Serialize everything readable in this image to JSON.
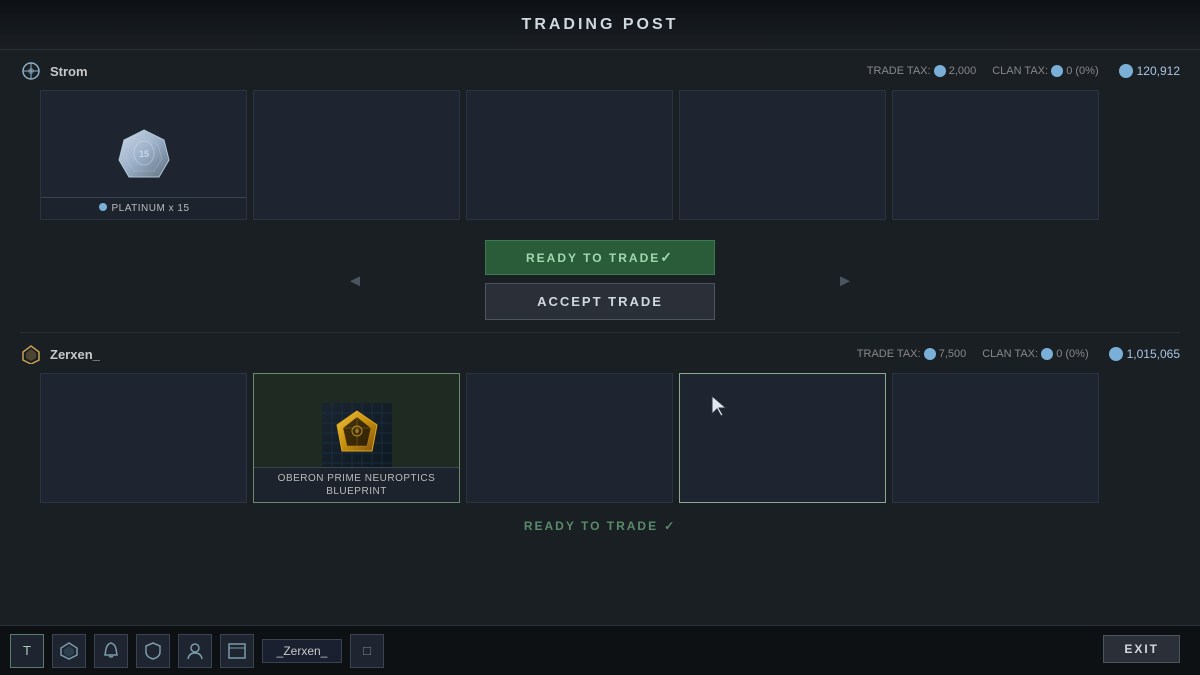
{
  "header": {
    "title": "TRADING POST"
  },
  "player1": {
    "name": "Strom",
    "platinum": "120,912",
    "trade_tax_label": "TRADE TAX:",
    "trade_tax": "2,000",
    "clan_tax_label": "CLAN TAX:",
    "clan_tax": "0 (0%)",
    "items": [
      {
        "id": "plat-slot",
        "label": "PLATINUM x 15",
        "has_item": true,
        "item_type": "platinum"
      },
      {
        "id": "slot2",
        "label": "",
        "has_item": false
      },
      {
        "id": "slot3",
        "label": "",
        "has_item": false
      },
      {
        "id": "slot4",
        "label": "",
        "has_item": false
      },
      {
        "id": "slot5",
        "label": "",
        "has_item": false
      }
    ]
  },
  "trade_actions": {
    "ready_label": "READY TO TRADE",
    "accept_label": "ACCEPT TRADE"
  },
  "player2": {
    "name": "Zerxen_",
    "platinum": "1,015,065",
    "trade_tax_label": "TRADE TAX:",
    "trade_tax": "7,500",
    "clan_tax_label": "CLAN TAX:",
    "clan_tax": "0 (0%)",
    "items": [
      {
        "id": "slot1",
        "label": "",
        "has_item": false
      },
      {
        "id": "oberon-slot",
        "label": "OBERON PRIME NEUROPTICS BLUEPRINT",
        "has_item": true,
        "item_type": "blueprint"
      },
      {
        "id": "slot3",
        "label": "",
        "has_item": false
      },
      {
        "id": "slot4-cursor",
        "label": "",
        "has_item": false,
        "has_cursor": true
      },
      {
        "id": "slot5",
        "label": "",
        "has_item": false
      }
    ],
    "ready_label": "READY TO TRADE"
  },
  "bottom_bar": {
    "buttons": [
      "T",
      "⚙",
      "🔔",
      "🛡",
      "👤",
      "⊞",
      "_Zerxen_",
      "□"
    ],
    "exit_label": "EXIT"
  }
}
